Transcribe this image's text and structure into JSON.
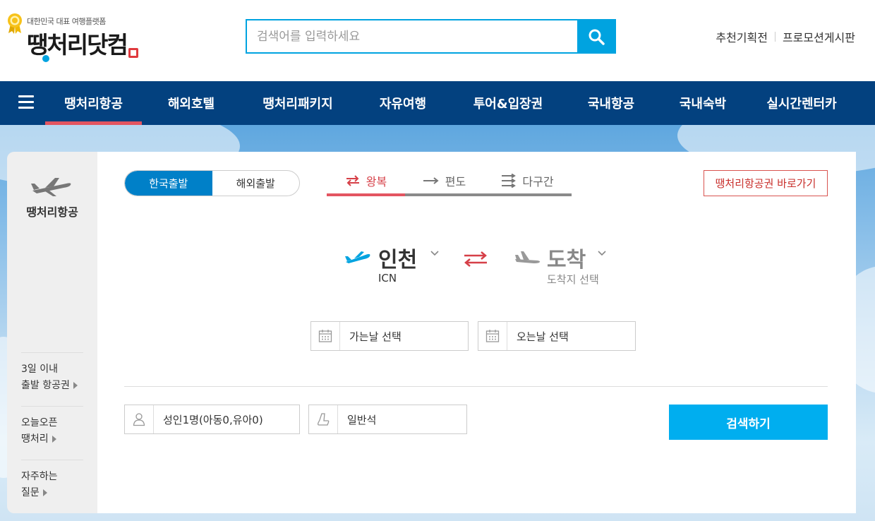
{
  "logo": {
    "tagline": "대한민국 대표 여행플랫폼",
    "brand": "땡처리닷컴"
  },
  "search": {
    "placeholder": "검색어를 입력하세요",
    "button_icon": "search-icon"
  },
  "top_links": [
    "추천기획전",
    "프로모션게시판"
  ],
  "nav": {
    "menu_icon": "hamburger-menu-icon",
    "items": [
      {
        "label": "땡처리항공",
        "active": true
      },
      {
        "label": "해외호텔",
        "active": false
      },
      {
        "label": "땡처리패키지",
        "active": false
      },
      {
        "label": "자유여행",
        "active": false
      },
      {
        "label": "투어&입장권",
        "active": false
      },
      {
        "label": "국내항공",
        "active": false
      },
      {
        "label": "국내숙박",
        "active": false
      },
      {
        "label": "실시간렌터카",
        "active": false
      }
    ]
  },
  "sidebar": {
    "title": "땡처리항공",
    "icon": "airplane-icon",
    "links": [
      {
        "line1": "3일 이내",
        "line2": "출발 항공권"
      },
      {
        "line1": "오늘오픈",
        "line2": "땡처리"
      },
      {
        "line1": "자주하는",
        "line2": "질문"
      }
    ]
  },
  "panel": {
    "departure_toggle": {
      "options": [
        "한국출발",
        "해외출발"
      ],
      "selected": "한국출발"
    },
    "trip_tabs": [
      {
        "label": "왕복",
        "icon": "round-trip-icon",
        "active": true
      },
      {
        "label": "편도",
        "icon": "one-way-icon",
        "active": false
      },
      {
        "label": "다구간",
        "icon": "multi-city-icon",
        "active": false
      }
    ],
    "shortcut_button": "땡처리항공권 바로가기",
    "route": {
      "departure_city": "인천",
      "departure_code": "ICN",
      "arrival_city": "도착",
      "arrival_placeholder": "도착지 선택"
    },
    "dates": {
      "depart": "가는날 선택",
      "return": "오는날 선택"
    },
    "passengers": "성인1명(아동0,유아0)",
    "seat_class": "일반석",
    "search_button": "검색하기"
  },
  "colors": {
    "brand_blue": "#00a3e0",
    "nav_bg": "#03417f",
    "accent_red": "#e35561",
    "toggle_blue": "#0080c8",
    "cta": "#00aeef"
  }
}
